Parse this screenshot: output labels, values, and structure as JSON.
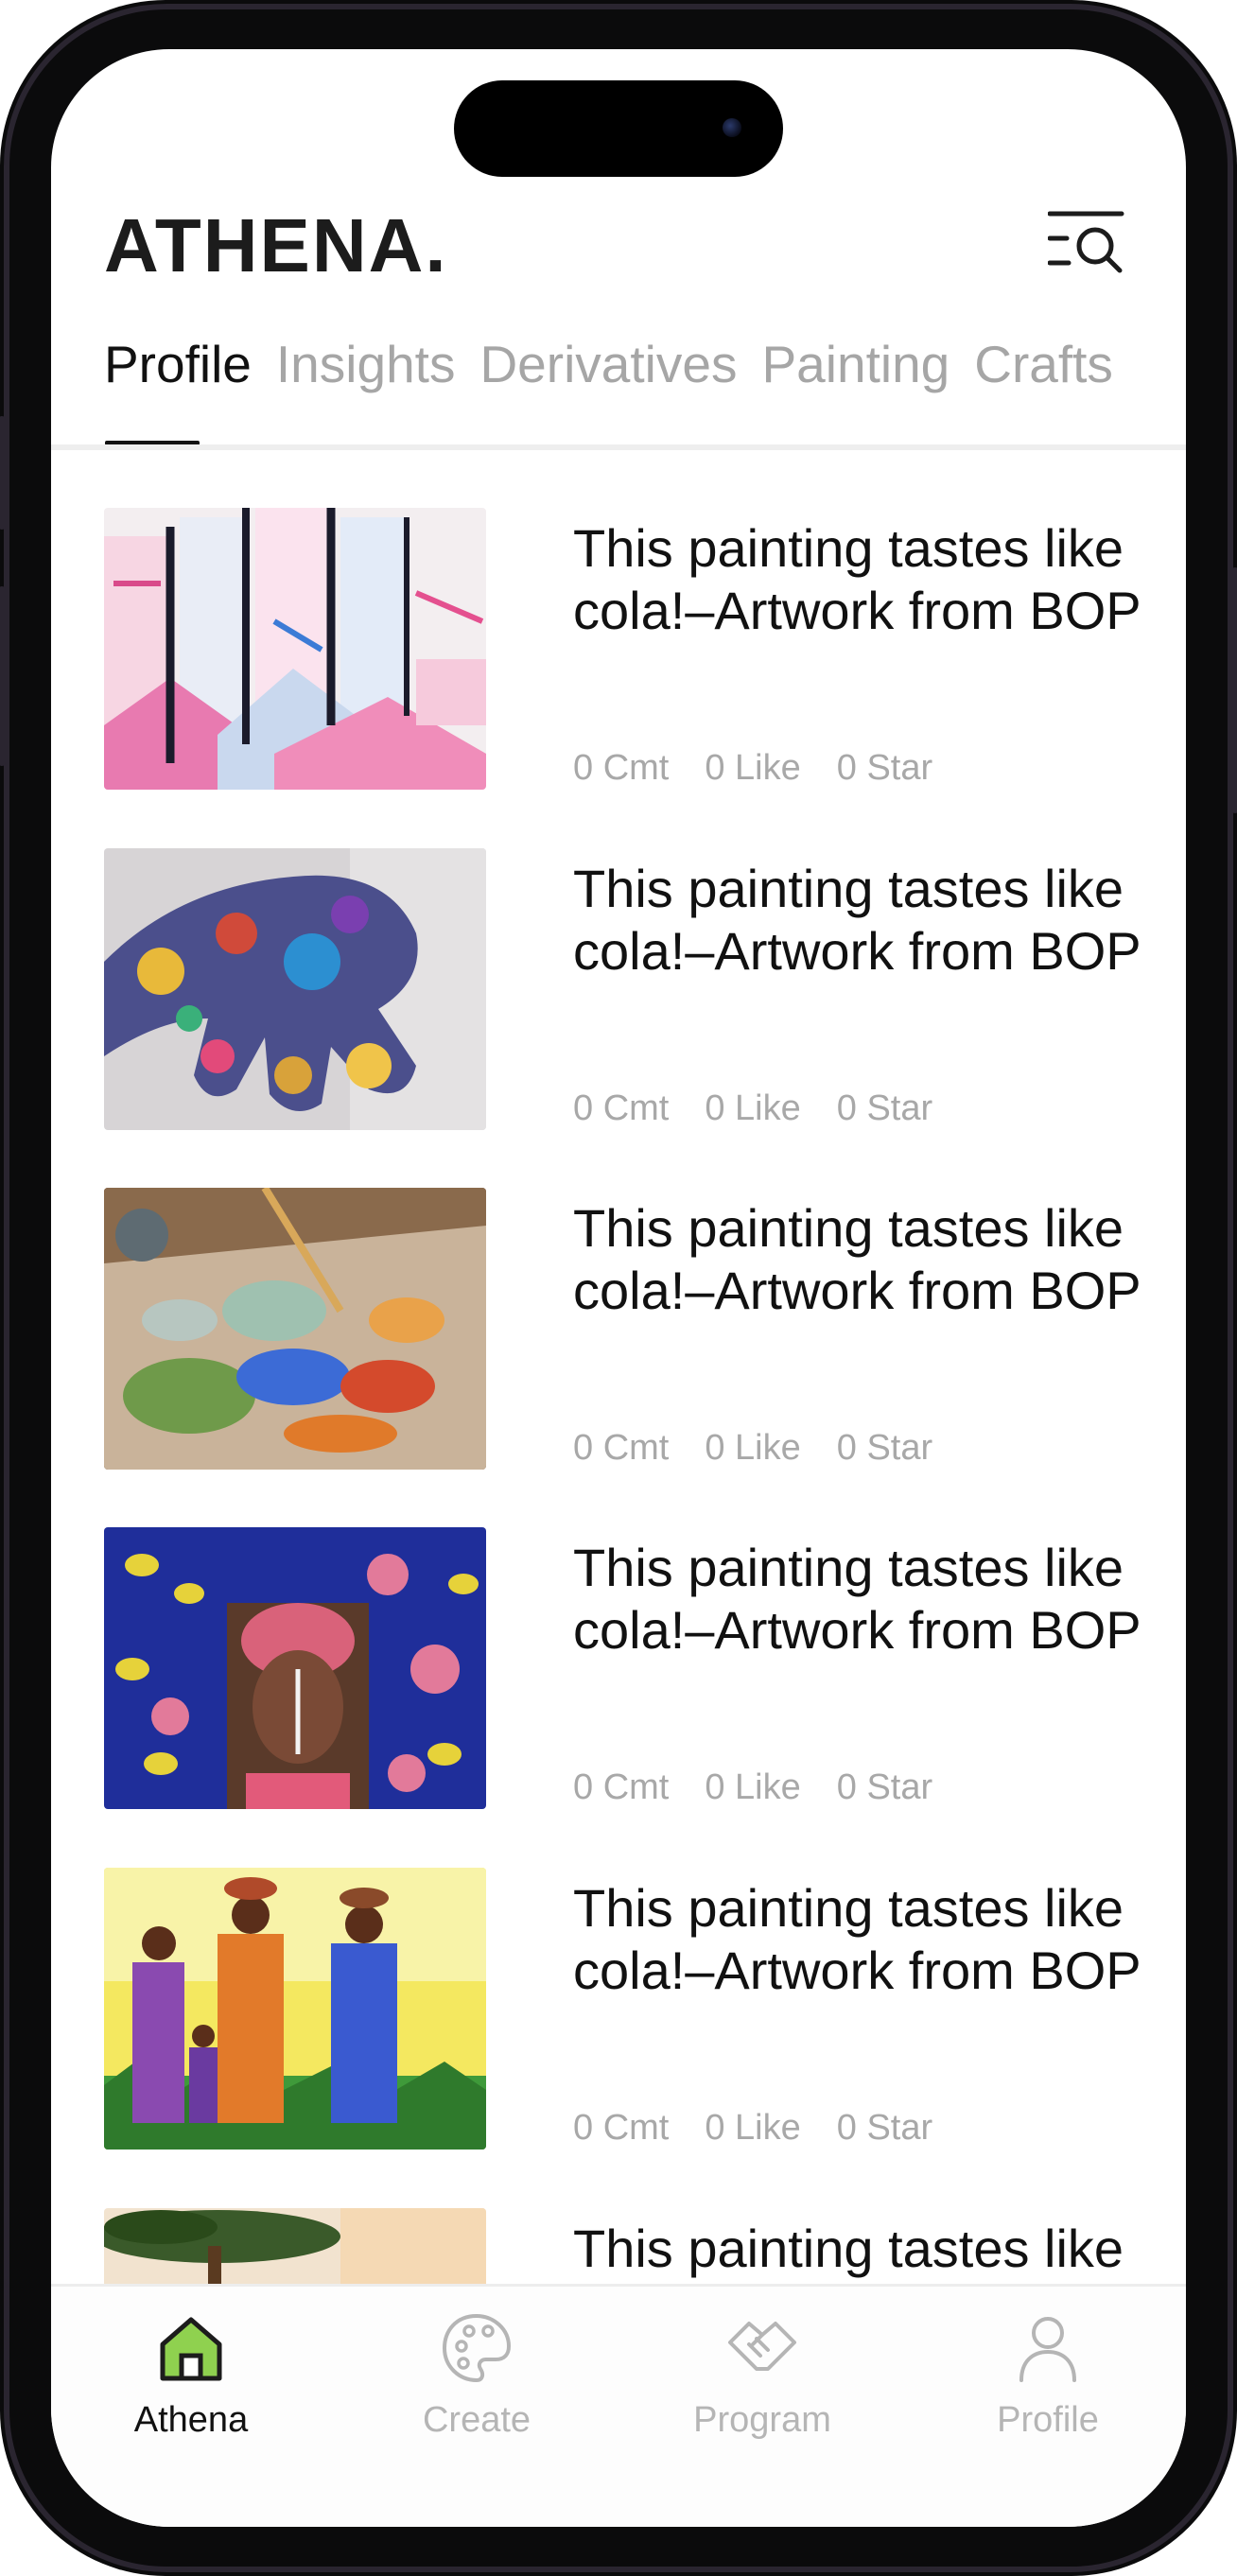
{
  "app": {
    "brand": "ATHENA."
  },
  "tabs": [
    {
      "label": "Profile",
      "active": true
    },
    {
      "label": "Insights",
      "active": false
    },
    {
      "label": "Derivatives",
      "active": false
    },
    {
      "label": "Painting",
      "active": false
    },
    {
      "label": "Crafts",
      "active": false
    }
  ],
  "feed": [
    {
      "title": "This painting tastes like cola!–Artwork from BOP",
      "comments": "0 Cmt",
      "likes": "0 Like",
      "stars": "0 Star",
      "image": "abstract-buildings"
    },
    {
      "title": "This painting tastes like cola!–Artwork from BOP",
      "comments": "0 Cmt",
      "likes": "0 Like",
      "stars": "0 Star",
      "image": "painted-hand"
    },
    {
      "title": "This painting tastes like cola!–Artwork from BOP",
      "comments": "0 Cmt",
      "likes": "0 Like",
      "stars": "0 Star",
      "image": "paint-palette"
    },
    {
      "title": "This painting tastes like cola!–Artwork from BOP",
      "comments": "0 Cmt",
      "likes": "0 Like",
      "stars": "0 Star",
      "image": "portrait-patterned"
    },
    {
      "title": "This painting tastes like cola!–Artwork from BOP",
      "comments": "0 Cmt",
      "likes": "0 Like",
      "stars": "0 Star",
      "image": "women-carrying-pots"
    },
    {
      "title": "This painting tastes like",
      "comments": "",
      "likes": "",
      "stars": "",
      "image": "tree-landscape"
    }
  ],
  "bottom_nav": [
    {
      "label": "Athena",
      "icon": "home-icon",
      "active": true
    },
    {
      "label": "Create",
      "icon": "palette-icon",
      "active": false
    },
    {
      "label": "Program",
      "icon": "handshake-icon",
      "active": false
    },
    {
      "label": "Profile",
      "icon": "user-icon",
      "active": false
    }
  ],
  "colors": {
    "accent": "#8fd14f",
    "text": "#111111",
    "muted": "#a6a6a6"
  }
}
